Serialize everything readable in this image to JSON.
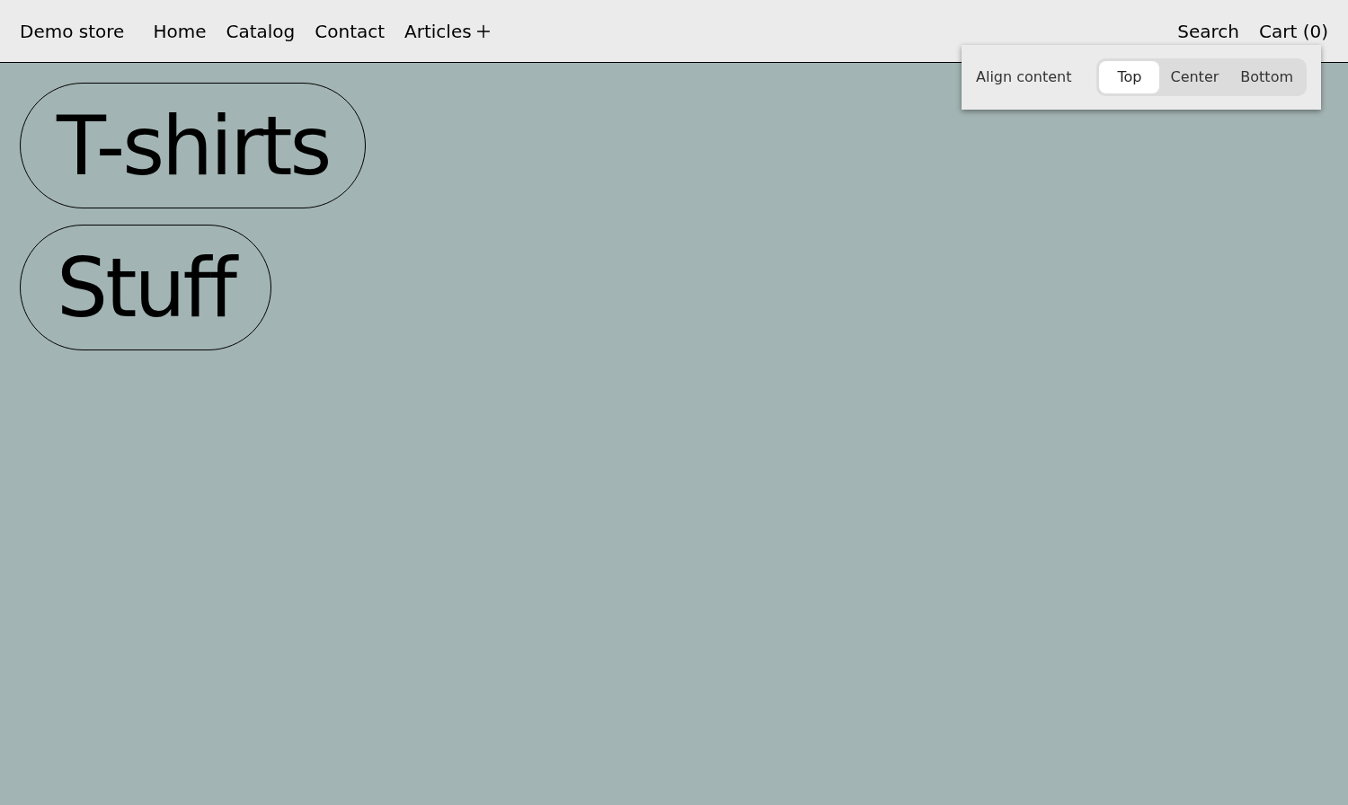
{
  "header": {
    "store_name": "Demo store",
    "nav": [
      {
        "label": "Home",
        "kind": "link"
      },
      {
        "label": "Catalog",
        "kind": "link"
      },
      {
        "label": "Contact",
        "kind": "link"
      },
      {
        "label": "Articles",
        "kind": "menu"
      }
    ],
    "actions": [
      "Search",
      "Cart (0)"
    ]
  },
  "collections": [
    {
      "title": "T-shirts"
    },
    {
      "title": "Stuff"
    }
  ],
  "popover": {
    "label": "Align content",
    "options": [
      {
        "label": "Top",
        "selected": true
      },
      {
        "label": "Center",
        "selected": false
      },
      {
        "label": "Bottom",
        "selected": false
      }
    ]
  }
}
